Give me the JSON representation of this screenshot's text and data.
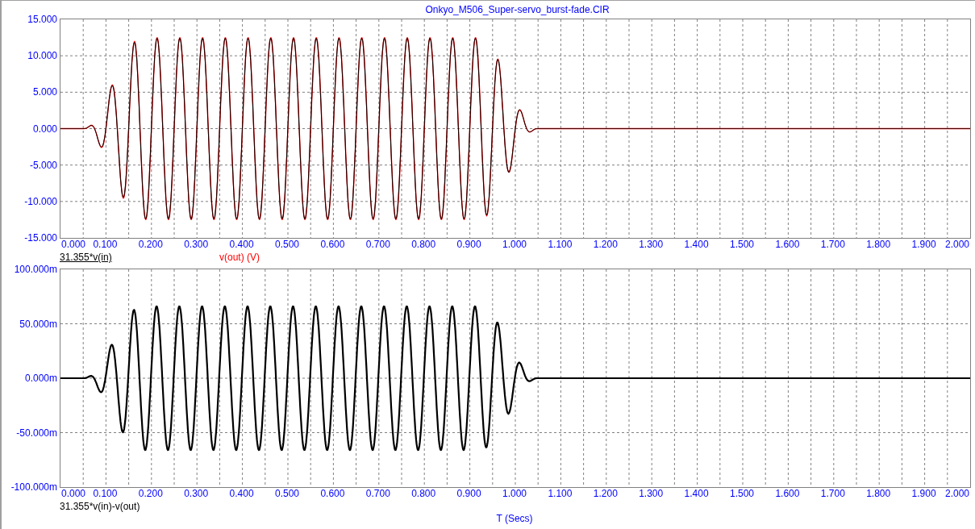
{
  "window": {
    "title": "Onkyo_M506_Super-servo_burst-fade.CIR"
  },
  "plots": [
    {
      "y_tick_labels": [
        "15.000",
        "10.000",
        "5.000",
        "0.000",
        "-5.000",
        "-10.000",
        "-15.000"
      ],
      "x_tick_labels": [
        "0.000",
        "0.100",
        "0.200",
        "0.300",
        "0.400",
        "0.500",
        "0.600",
        "0.700",
        "0.800",
        "0.900",
        "1.000",
        "1.100",
        "1.200",
        "1.300",
        "1.400",
        "1.500",
        "1.600",
        "1.700",
        "1.800",
        "1.900",
        "2.000"
      ],
      "legends": [
        {
          "text": "31.355*v(in)",
          "color": "#000000",
          "underlined": true
        },
        {
          "text": "v(out) (V)",
          "color": "#ff0000",
          "underlined": false
        }
      ]
    },
    {
      "y_tick_labels": [
        "100.000m",
        "50.000m",
        "0.000m",
        "-50.000m",
        "-100.000m"
      ],
      "x_tick_labels": [
        "0.000",
        "0.100",
        "0.200",
        "0.300",
        "0.400",
        "0.500",
        "0.600",
        "0.700",
        "0.800",
        "0.900",
        "1.000",
        "1.100",
        "1.200",
        "1.300",
        "1.400",
        "1.500",
        "1.600",
        "1.700",
        "1.800",
        "1.900",
        "2.000"
      ],
      "legends": [
        {
          "text": "31.355*v(in)-v(out)",
          "color": "#000000",
          "underlined": false
        }
      ],
      "axis_title": "T (Secs)"
    }
  ]
}
